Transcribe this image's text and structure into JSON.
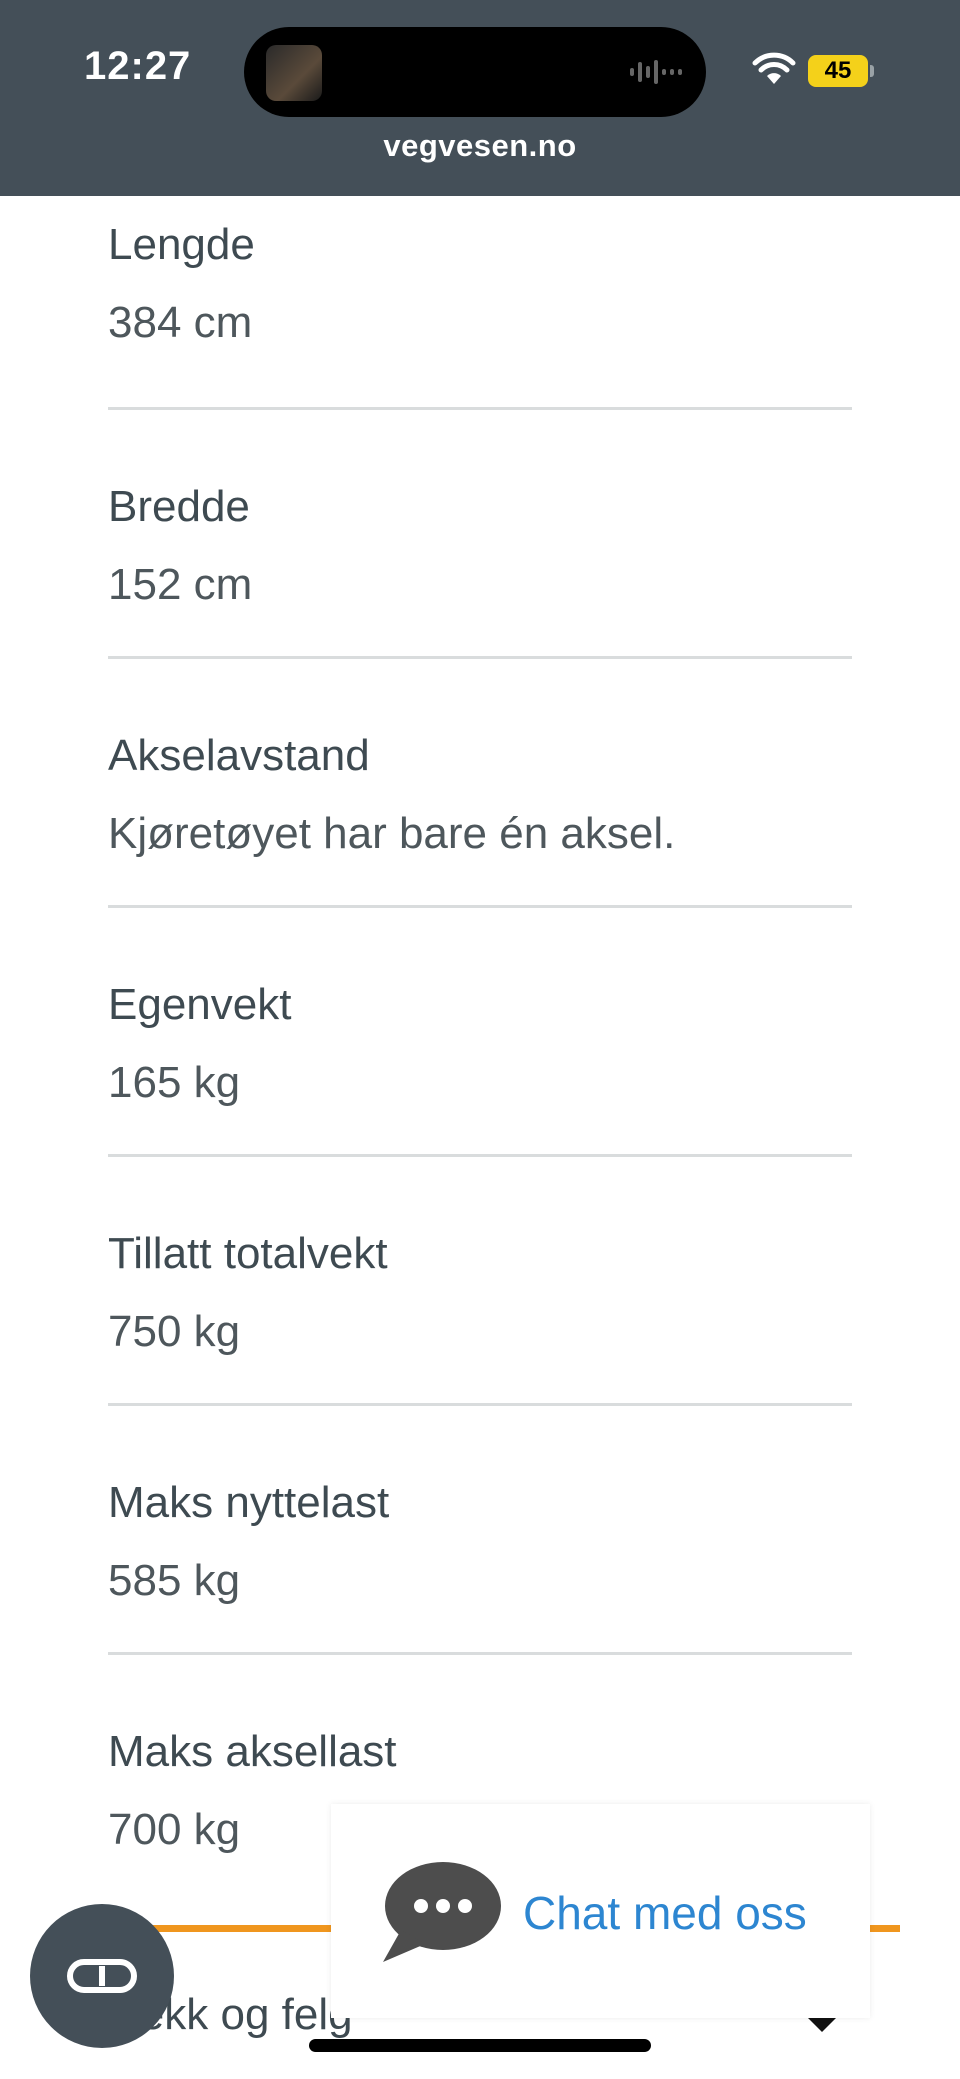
{
  "status": {
    "time": "12:27",
    "battery": "45",
    "url": "vegvesen.no"
  },
  "specs": [
    {
      "label": "Lengde",
      "value": "384 cm"
    },
    {
      "label": "Bredde",
      "value": "152 cm"
    },
    {
      "label": "Akselavstand",
      "value": "Kjøretøyet har bare én aksel."
    },
    {
      "label": "Egenvekt",
      "value": "165 kg"
    },
    {
      "label": "Tillatt totalvekt",
      "value": "750 kg"
    },
    {
      "label": "Maks nyttelast",
      "value": "585 kg"
    },
    {
      "label": "Maks aksellast",
      "value": "700 kg"
    }
  ],
  "next_section": {
    "heading": "Dekk og felg"
  },
  "chat": {
    "label": "Chat med oss"
  },
  "icons": {
    "wifi": "wifi-icon",
    "chat": "chat-bubble-icon",
    "glasses": "glasses-icon",
    "chevron": "chevron-down-icon"
  },
  "colors": {
    "status_bar": "#444f58",
    "accent_orange": "#f0961e",
    "link_blue": "#2d86d1",
    "battery_yellow": "#f4d11a"
  }
}
